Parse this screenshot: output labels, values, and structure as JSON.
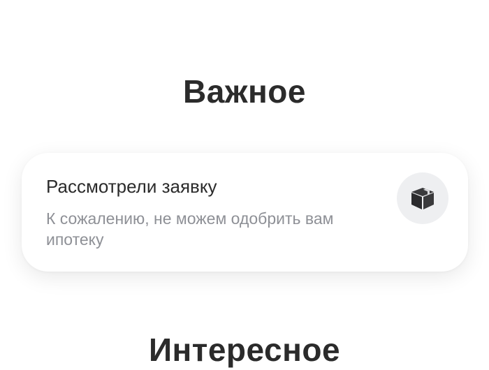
{
  "sections": {
    "important_title": "Важное",
    "interesting_title": "Интересное"
  },
  "notification": {
    "title": "Рассмотрели заявку",
    "text": "К сожалению, не можем одобрить вам ипотеку",
    "icon": "box-icon"
  },
  "colors": {
    "heading": "#2b2b2b",
    "secondary_text": "#8e9096",
    "icon_bg": "#eeeff1"
  }
}
